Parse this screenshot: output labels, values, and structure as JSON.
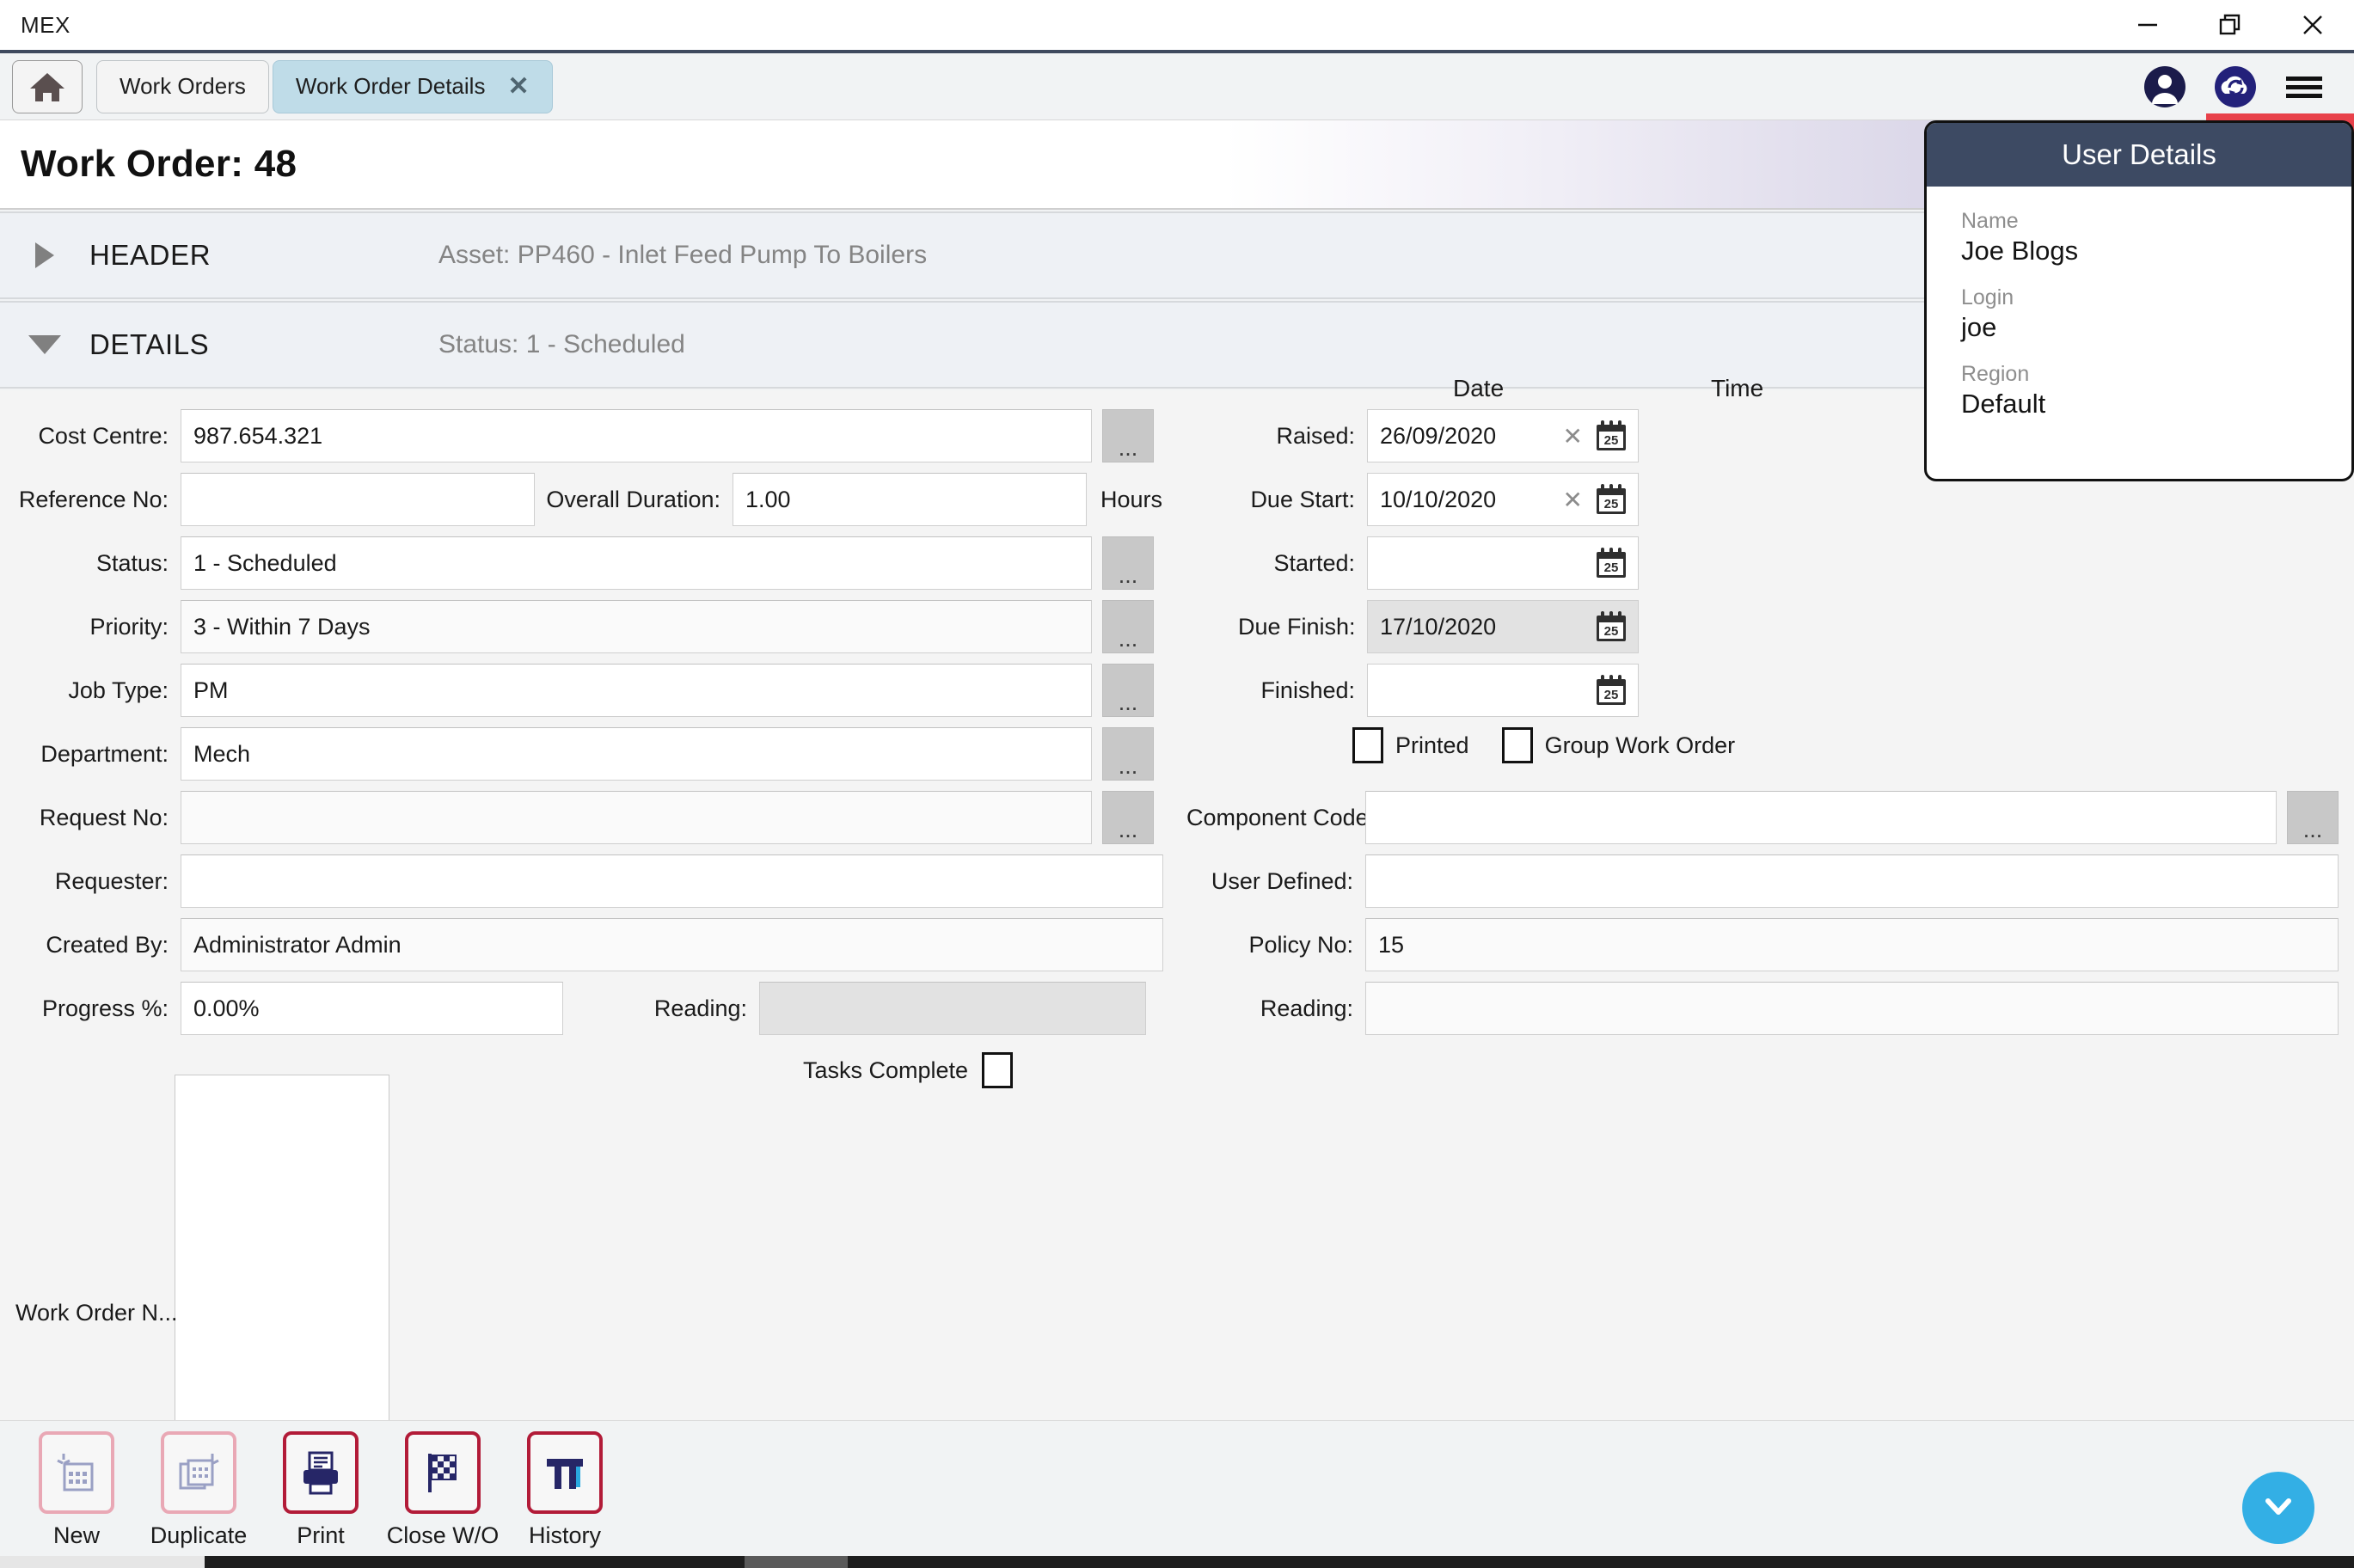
{
  "window": {
    "title": "MEX",
    "minimize_label": "Minimize",
    "maximize_label": "Restore",
    "close_label": "Close"
  },
  "tabs": {
    "home_label": "Home",
    "items": [
      {
        "label": "Work Orders",
        "active": false,
        "closable": false
      },
      {
        "label": "Work Order Details",
        "active": true,
        "closable": true,
        "close_glyph": "✕"
      }
    ],
    "right_icons": [
      {
        "name": "user-account-icon",
        "label": "User Account"
      },
      {
        "name": "cloud-sync-icon",
        "label": "Cloud Sync"
      },
      {
        "name": "hamburger-menu-icon",
        "label": "Menu"
      }
    ]
  },
  "page": {
    "title": "Work Order: 48"
  },
  "accordion": [
    {
      "name": "header",
      "label": "HEADER",
      "summary": "Asset: PP460 - Inlet Feed Pump To Boilers",
      "expanded": false
    },
    {
      "name": "details",
      "label": "DETAILS",
      "summary": "Status: 1 - Scheduled",
      "expanded": true
    }
  ],
  "form": {
    "left": {
      "cost_centre": {
        "label": "Cost Centre:",
        "value": "987.654.321",
        "placeholder": ""
      },
      "reference_no": {
        "label": "Reference No:",
        "value": "",
        "placeholder": ""
      },
      "overall_duration": {
        "label": "Overall Duration:",
        "value": "1.00",
        "placeholder": "",
        "unit": "Hours"
      },
      "status": {
        "label": "Status:",
        "value": "1 - Scheduled",
        "placeholder": ""
      },
      "priority": {
        "label": "Priority:",
        "value": "3 - Within 7 Days",
        "placeholder": ""
      },
      "job_type": {
        "label": "Job Type:",
        "value": "PM",
        "placeholder": ""
      },
      "department": {
        "label": "Department:",
        "value": "Mech",
        "placeholder": ""
      },
      "request_no": {
        "label": "Request No:",
        "value": "",
        "placeholder": ""
      },
      "requester": {
        "label": "Requester:",
        "value": "",
        "placeholder": ""
      },
      "created_by": {
        "label": "Created By:",
        "value": "Administrator Admin",
        "placeholder": ""
      },
      "progress_pct": {
        "label": "Progress %:",
        "value": "0.00%",
        "placeholder": ""
      },
      "reading": {
        "label": "Reading:",
        "value": "",
        "placeholder": ""
      },
      "tasks_complete": {
        "label": "Tasks Complete",
        "checked": false
      },
      "work_order_notes": {
        "label": "Work Order N...",
        "value": "",
        "placeholder": ""
      }
    },
    "right": {
      "col_date": "Date",
      "col_time": "Time",
      "raised": {
        "label": "Raised:",
        "value": "26/09/2020",
        "clearable": true,
        "disabled": false
      },
      "due_start": {
        "label": "Due Start:",
        "value": "10/10/2020",
        "clearable": true,
        "disabled": false
      },
      "started": {
        "label": "Started:",
        "value": "",
        "clearable": false,
        "disabled": false
      },
      "due_finish": {
        "label": "Due Finish:",
        "value": "17/10/2020",
        "clearable": false,
        "disabled": true
      },
      "finished": {
        "label": "Finished:",
        "value": "",
        "clearable": false,
        "disabled": false
      },
      "printed": {
        "label": "Printed",
        "checked": false
      },
      "group_work_order": {
        "label": "Group Work Order",
        "checked": false
      },
      "component_code": {
        "label": "Component Code:",
        "value": "",
        "placeholder": ""
      },
      "user_defined": {
        "label": "User Defined:",
        "value": "",
        "placeholder": ""
      },
      "policy_no": {
        "label": "Policy No:",
        "value": "15",
        "placeholder": ""
      },
      "reading": {
        "label": "Reading:",
        "value": "",
        "placeholder": ""
      }
    },
    "lookup_button_label": "..."
  },
  "user_details_popup": {
    "title": "User Details",
    "fields": [
      {
        "label": "Name",
        "value": "Joe Blogs"
      },
      {
        "label": "Login",
        "value": "joe"
      },
      {
        "label": "Region",
        "value": "Default"
      }
    ]
  },
  "toolbar": {
    "buttons": [
      {
        "name": "new",
        "label": "New",
        "icon": "new-record-icon",
        "enabled": false
      },
      {
        "name": "duplicate",
        "label": "Duplicate",
        "icon": "duplicate-icon",
        "enabled": false
      },
      {
        "name": "print",
        "label": "Print",
        "icon": "printer-icon",
        "enabled": true
      },
      {
        "name": "close_wo",
        "label": "Close W/O",
        "icon": "checkered-flag-icon",
        "enabled": true
      },
      {
        "name": "history",
        "label": "History",
        "icon": "history-pi-icon",
        "enabled": true
      }
    ]
  },
  "fab": {
    "label": "Expand",
    "icon": "chevron-down-icon",
    "color": "#33afe5"
  },
  "colors": {
    "accent_red": "#b21b38",
    "popup_header": "#3d4a63",
    "tab_active": "#bfdce8",
    "fab_blue": "#33afe5",
    "banner_purple": "#7a73b4"
  }
}
